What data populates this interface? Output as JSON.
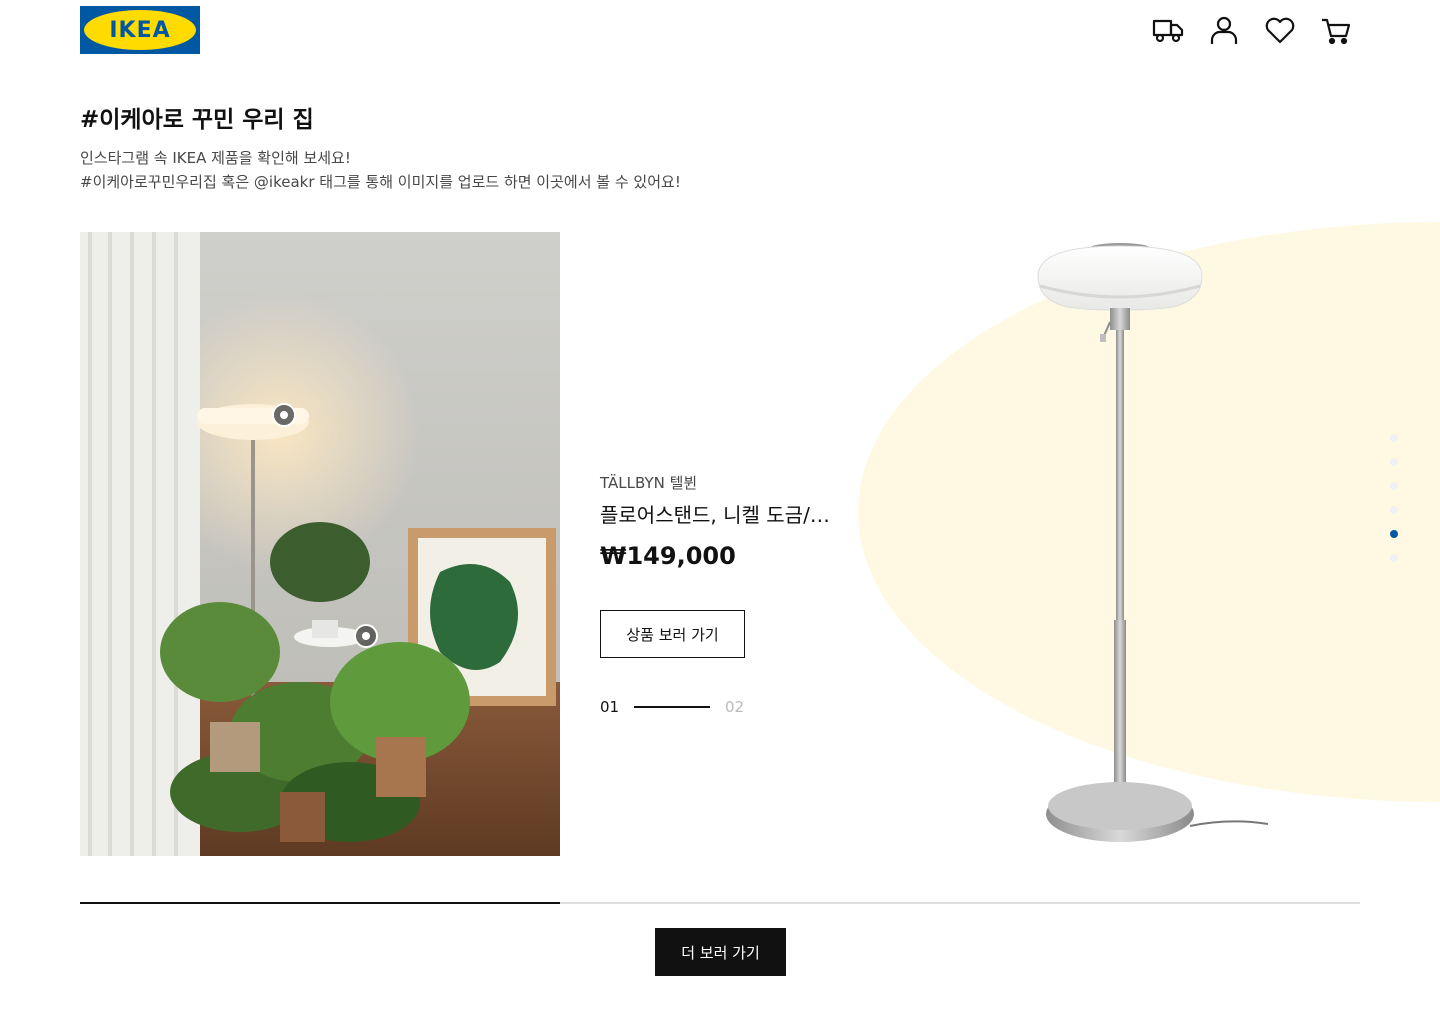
{
  "header": {
    "logo_text": "IKEA",
    "icons": [
      "delivery-truck-icon",
      "user-icon",
      "heart-icon",
      "cart-icon"
    ]
  },
  "section": {
    "title": "#이케아로 꾸민 우리 집",
    "desc_line1": "인스타그램 속 IKEA 제품을 확인해 보세요!",
    "desc_line2": "#이케아로꾸민우리집 혹은 @ikeakr 태그를 통해 이미지를 업로드 하면 이곳에서 볼 수 있어요!"
  },
  "product": {
    "name": "TÄLLBYN 텔뷘",
    "desc": "플로어스탠드, 니켈 도금/오팔 화이트 유리",
    "price": "₩149,000",
    "button_label": "상품 보러 가기"
  },
  "pager": {
    "current": "01",
    "next": "02"
  },
  "slider": {
    "dot_count": 6,
    "active_index": 4,
    "progress": 0.375
  },
  "more_button_label": "더 보러 가기",
  "colors": {
    "ikea_blue": "#0058a3",
    "ikea_yellow": "#ffdb00",
    "blob": "#fff9e3",
    "active_dot": "#0058a3"
  }
}
